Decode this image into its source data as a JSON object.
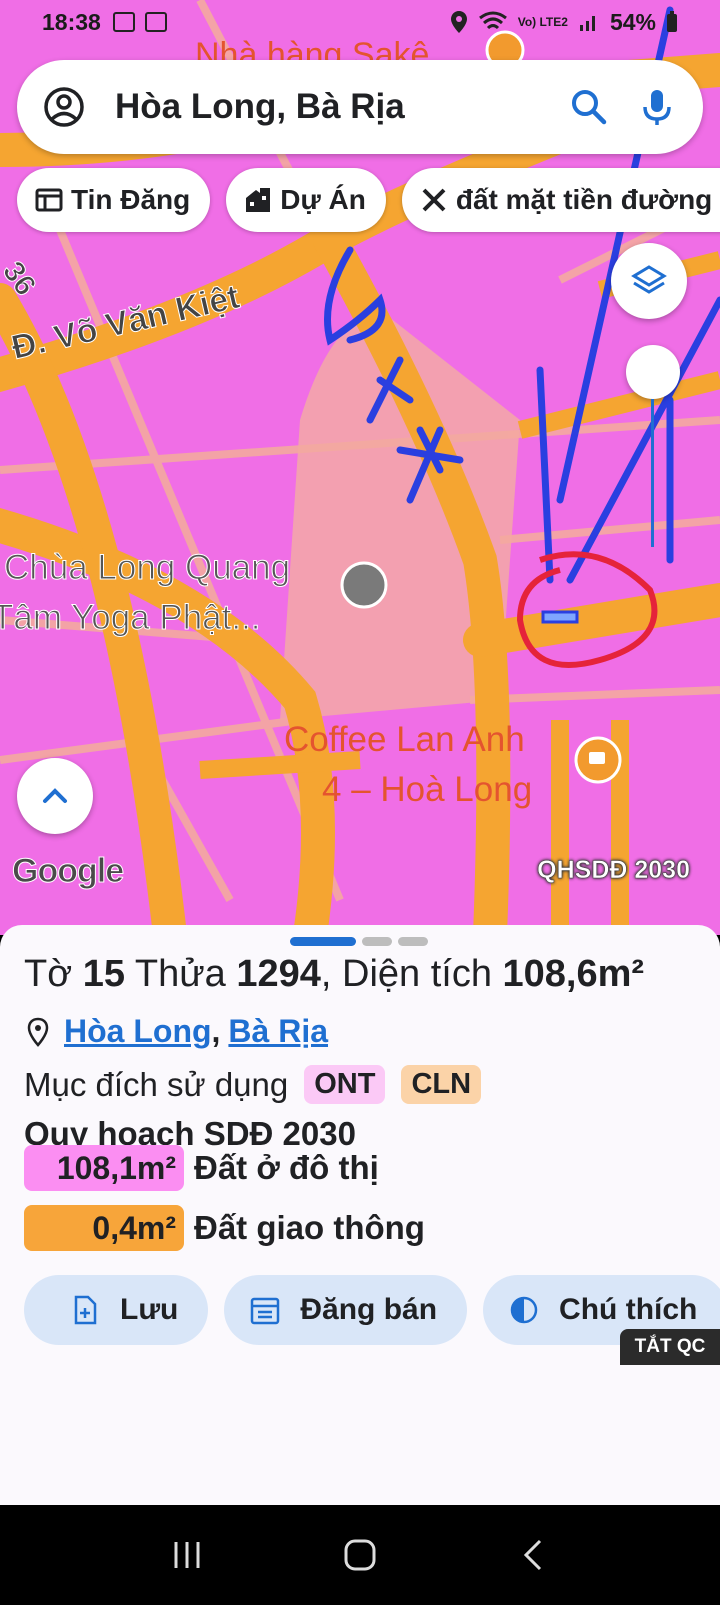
{
  "status_bar": {
    "time": "18:38",
    "battery": "54%",
    "network": "Vo) LTE2"
  },
  "search": {
    "query": "Hòa Long, Bà Rịa"
  },
  "chips": [
    {
      "label": "Tin Đăng",
      "icon": "listing-icon"
    },
    {
      "label": "Dự Án",
      "icon": "building-icon"
    },
    {
      "label": "đất mặt tiền đường s",
      "icon": "tools-icon"
    }
  ],
  "map": {
    "labels": {
      "restaurant": "Nhà hàng Sakê",
      "road_36": "36",
      "road_vvk": "Đ. Võ Văn Kiệt",
      "pagoda": "Chùa Long Quang",
      "yoga": "Tâm Yoga Phật...",
      "coffee_line1": "Coffee Lan Anh",
      "coffee_line2": "4 – Hoà Long",
      "google": "Google",
      "plan_code": "QHSDĐ 2030"
    },
    "colors": {
      "residential": "#f06ee6",
      "road": "#f5a531",
      "park": "#f3a0b0"
    }
  },
  "parcel": {
    "sheet_label": "Tờ",
    "sheet_number": "15",
    "parcel_label": "Thửa",
    "parcel_number": "1294",
    "area_label": ", Diện tích",
    "area_value": "108,6m²",
    "ward": "Hòa Long",
    "city": "Bà Rịa",
    "purpose_label": "Mục đích sử dụng",
    "purpose_tags": [
      "ONT",
      "CLN"
    ],
    "plan_title": "Quy hoạch SDĐ 2030",
    "plan_items": [
      {
        "area": "108,1m²",
        "label": "Đất ở đô thị",
        "color": "#fb8ef2"
      },
      {
        "area": "0,4m²",
        "label": "Đất giao thông",
        "color": "#f7a53a"
      }
    ]
  },
  "actions": [
    {
      "label": "Lưu",
      "icon": "save-icon"
    },
    {
      "label": "Đăng bán",
      "icon": "calendar-icon"
    },
    {
      "label": "Chú thích",
      "icon": "legend-icon"
    }
  ],
  "ad_toggle": "TẮT QC"
}
